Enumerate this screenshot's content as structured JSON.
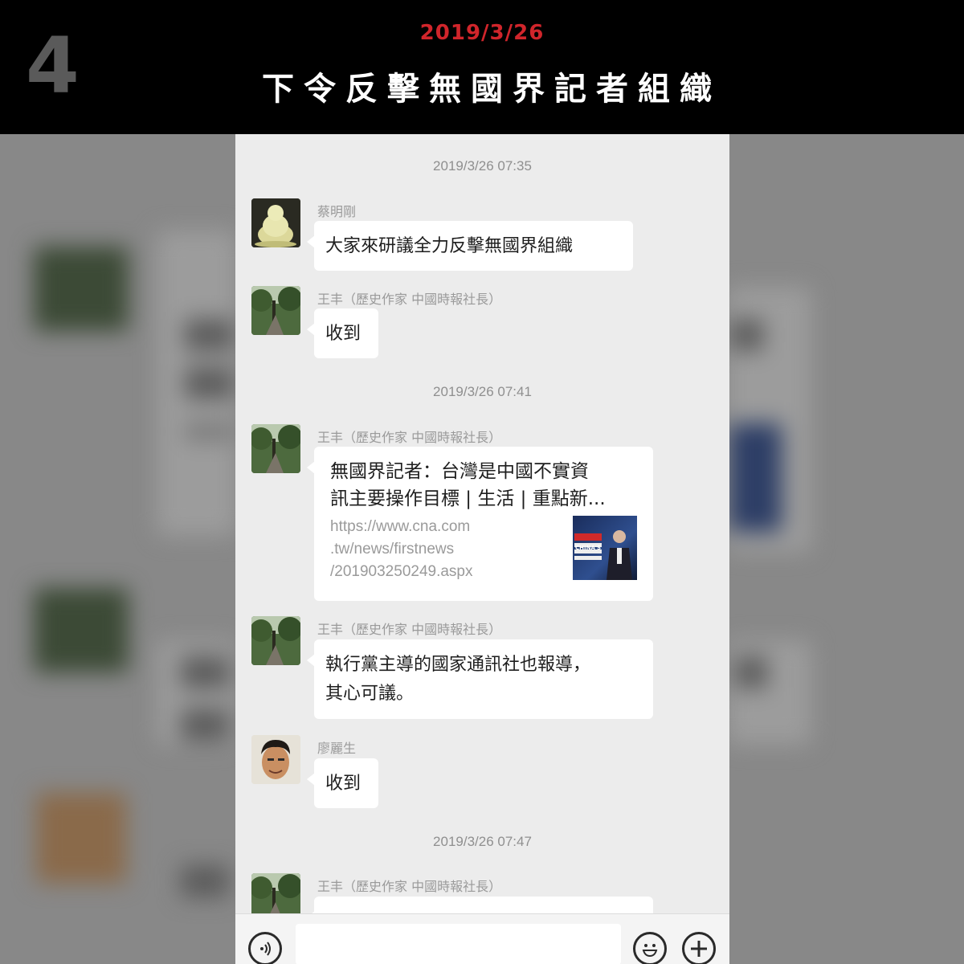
{
  "banner": {
    "step_number": "4",
    "date": "2019/3/26",
    "title": "下令反擊無國界記者組織"
  },
  "chat": {
    "messages": [
      {
        "type": "timestamp",
        "text": "2019/3/26 07:35"
      },
      {
        "type": "message",
        "sender": "蔡明剛",
        "avatar": "buddha-statue",
        "text": "大家來研議全力反擊無國界組織"
      },
      {
        "type": "message",
        "sender": "王丰（歷史作家 中國時報社長）",
        "avatar": "tree-path",
        "text": "收到"
      },
      {
        "type": "timestamp",
        "text": "2019/3/26 07:41"
      },
      {
        "type": "link",
        "sender": "王丰（歷史作家 中國時報社長）",
        "avatar": "tree-path",
        "title_line1": "無國界記者：台灣是中國不實資",
        "title_line2": "訊主要操作目標 | 生活 | 重點新...",
        "url_line1": "https://www.cna.com",
        "url_line2": ".tw/news/firstnews",
        "url_line3": "/201903250249.aspx",
        "thumb_text": "CHINA'S"
      },
      {
        "type": "message",
        "sender": "王丰（歷史作家 中國時報社長）",
        "avatar": "tree-path",
        "text_line1": "執行黨主導的國家通訊社也報導，",
        "text_line2": "其心可議。"
      },
      {
        "type": "message",
        "sender": "廖麗生",
        "avatar": "man-face",
        "text": "收到"
      },
      {
        "type": "timestamp",
        "text": "2019/3/26 07:47"
      },
      {
        "type": "message",
        "sender": "王丰（歷史作家 中國時報社長）",
        "avatar": "tree-path",
        "text": ""
      }
    ]
  },
  "inputbar": {
    "voice_icon": "voice-icon",
    "emoji_icon": "emoji-icon",
    "plus_icon": "plus-icon"
  },
  "colors": {
    "banner_bg": "#000000",
    "date_red": "#d0252b",
    "chat_bg": "#ececec"
  }
}
